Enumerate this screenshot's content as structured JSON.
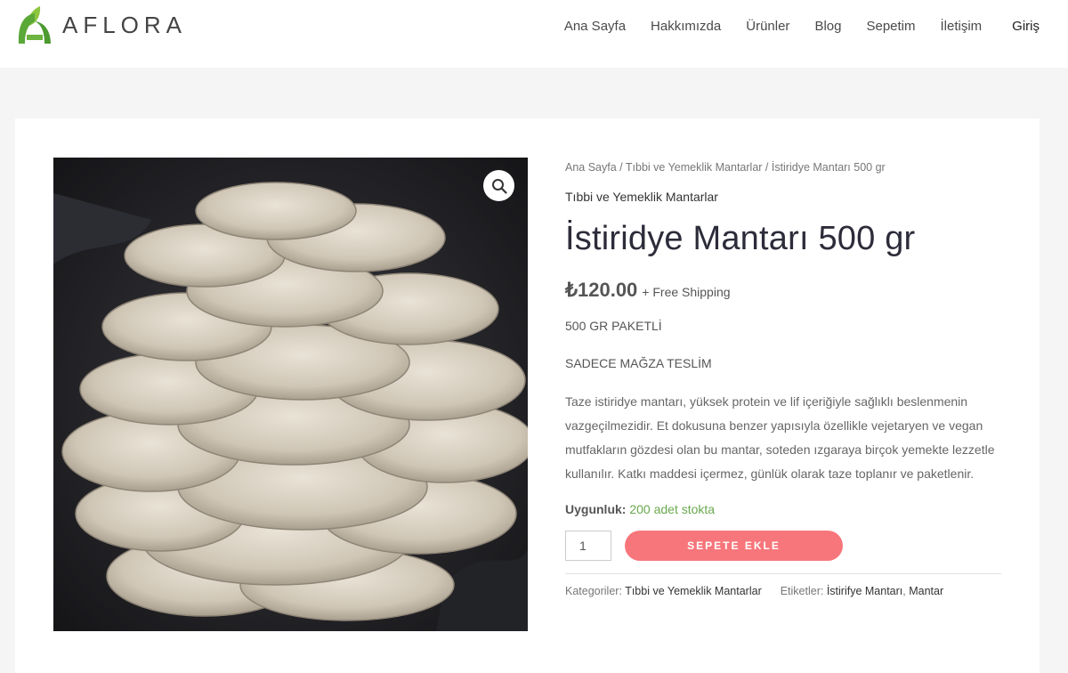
{
  "brand": {
    "name": "AFLORA"
  },
  "nav": {
    "items": [
      "Ana Sayfa",
      "Hakkımızda",
      "Ürünler",
      "Blog",
      "Sepetim",
      "İletişim"
    ],
    "login": "Giriş"
  },
  "breadcrumb": {
    "home": "Ana Sayfa",
    "sep": " / ",
    "category": "Tıbbi ve Yemeklik Mantarlar",
    "current": "İstiridye Mantarı 500 gr"
  },
  "product": {
    "category": "Tıbbi ve Yemeklik Mantarlar",
    "title": "İstiridye Mantarı 500 gr",
    "price": "₺120.00",
    "shipping": "+ Free Shipping",
    "line1": "500 GR PAKETLİ",
    "line2": "SADECE MAĞZA TESLİM",
    "description": "Taze istiridye mantarı, yüksek protein ve lif içeriğiyle sağlıklı beslenmenin vazgeçilmezidir. Et dokusuna benzer yapısıyla özellikle vejetaryen ve vegan mutfakların gözdesi olan bu mantar, soteden ızgaraya birçok yemekte lezzetle kullanılır. Katkı maddesi içermez, günlük olarak taze toplanır ve paketlenir.",
    "stock_label": "Uygunluk:",
    "stock_value": "200 adet stokta",
    "quantity": "1",
    "add_to_cart": "SEPETE EKLE",
    "categories_label": "Kategoriler:",
    "categories_value": "Tıbbi ve Yemeklik Mantarlar",
    "tags_label": "Etiketler:",
    "tags": [
      "İstirifye Mantarı",
      "Mantar"
    ]
  },
  "icons": {
    "logo": "leaf-a-logo-icon",
    "zoom": "magnifier-icon"
  },
  "colors": {
    "accent": "#f7767b",
    "stock": "#6aa84f",
    "logo_green": "#5aa838"
  }
}
